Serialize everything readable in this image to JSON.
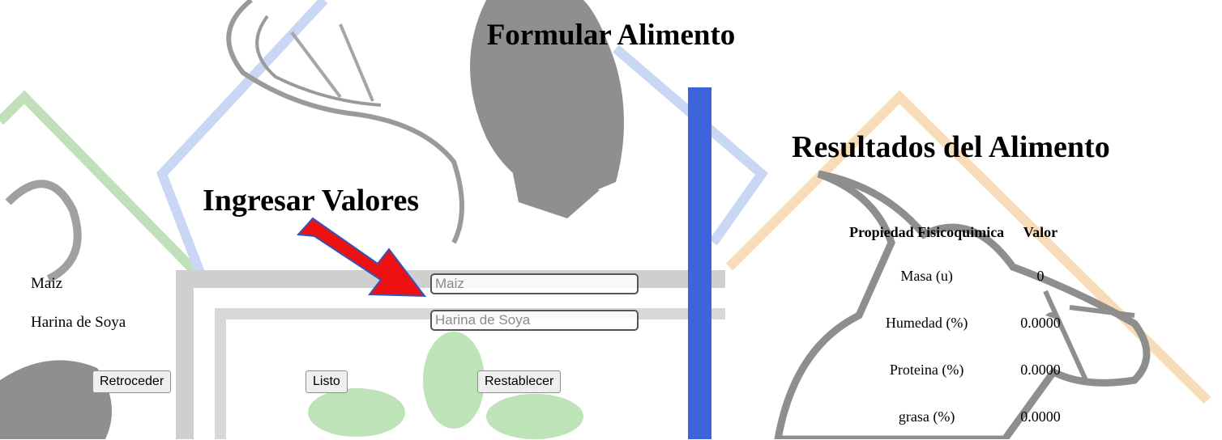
{
  "page": {
    "title": "Formular Alimento"
  },
  "input_section": {
    "heading": "Ingresar Valores",
    "fields": [
      {
        "label": "Maiz",
        "placeholder": "Maiz",
        "value": ""
      },
      {
        "label": "Harina de Soya",
        "placeholder": "Harina de Soya",
        "value": ""
      }
    ],
    "buttons": {
      "back": "Retroceder",
      "done": "Listo",
      "reset": "Restablecer"
    }
  },
  "results_section": {
    "heading": "Resultados del Alimento",
    "columns": [
      "Propiedad Fisicoquimica",
      "Valor"
    ],
    "rows": [
      {
        "property": "Masa (u)",
        "value": "0"
      },
      {
        "property": "Humedad (%)",
        "value": "0.0000"
      },
      {
        "property": "Proteina (%)",
        "value": "0.0000"
      },
      {
        "property": "grasa (%)",
        "value": "0.0000"
      }
    ]
  },
  "colors": {
    "divider": "#3d63dd",
    "arrow": "#ee1111",
    "arrow_outline": "#3355bb"
  }
}
